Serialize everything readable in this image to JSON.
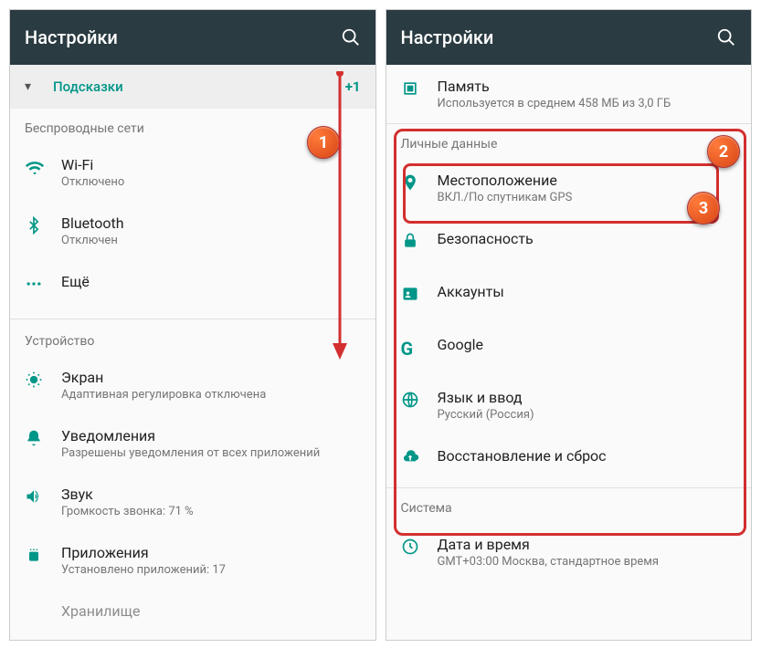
{
  "left": {
    "title": "Настройки",
    "hints_label": "Подсказки",
    "hints_badge": "+1",
    "section_wireless": "Беспроводные сети",
    "wifi": {
      "title": "Wi-Fi",
      "sub": "Отключено"
    },
    "bluetooth": {
      "title": "Bluetooth",
      "sub": "Отключен"
    },
    "more": {
      "title": "Ещё"
    },
    "section_device": "Устройство",
    "display": {
      "title": "Экран",
      "sub": "Адаптивная регулировка отключена"
    },
    "notifications": {
      "title": "Уведомления",
      "sub": "Разрешены уведомления от всех приложений"
    },
    "sound": {
      "title": "Звук",
      "sub": "Громкость звонка: 71 %"
    },
    "apps": {
      "title": "Приложения",
      "sub": "Установлено приложений: 17"
    },
    "storage_partial": "Хранилище"
  },
  "right": {
    "title": "Настройки",
    "memory": {
      "title": "Память",
      "sub": "Используется в среднем 458 МБ из 3,0 ГБ"
    },
    "section_personal": "Личные данные",
    "location": {
      "title": "Местоположение",
      "sub": "ВКЛ./По спутникам GPS"
    },
    "security": {
      "title": "Безопасность"
    },
    "accounts": {
      "title": "Аккаунты"
    },
    "google": {
      "title": "Google"
    },
    "language": {
      "title": "Язык и ввод",
      "sub": "Русский (Россия)"
    },
    "backup": {
      "title": "Восстановление и сброс"
    },
    "section_system": "Система",
    "datetime": {
      "title": "Дата и время",
      "sub": "GMT+03:00 Москва, стандартное время"
    }
  },
  "callouts": {
    "one": "1",
    "two": "2",
    "three": "3"
  }
}
